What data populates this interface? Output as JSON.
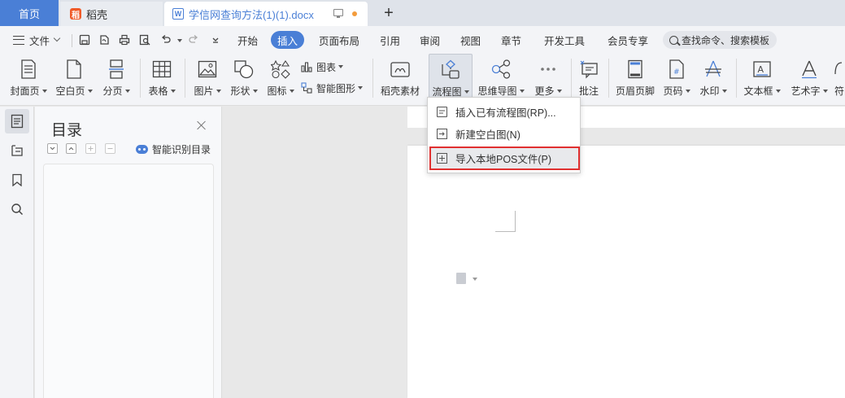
{
  "tabs": {
    "home": "首页",
    "daoke": "稻壳",
    "doc": "学信网查询方法(1)(1).docx",
    "add": "+"
  },
  "menu": {
    "file": "文件",
    "tabs": [
      "开始",
      "插入",
      "页面布局",
      "引用",
      "审阅",
      "视图",
      "章节",
      "开发工具",
      "会员专享"
    ],
    "active_tab": "插入",
    "search": "查找命令、搜索模板"
  },
  "ribbon": {
    "cover": "封面页",
    "blank": "空白页",
    "pagebreak": "分页",
    "table": "表格",
    "picture": "图片",
    "shape": "形状",
    "icon": "图标",
    "chart": "图表",
    "smartart": "智能图形",
    "daoke_material": "稻壳素材",
    "flowchart": "流程图",
    "mindmap": "思维导图",
    "more": "更多",
    "comment": "批注",
    "header_footer": "页眉页脚",
    "page_number": "页码",
    "watermark": "水印",
    "textbox": "文本框",
    "wordart": "艺术字",
    "symbol": "符"
  },
  "panel": {
    "title": "目录",
    "smart_recognize": "智能识别目录"
  },
  "dropdown": {
    "items": [
      "插入已有流程图(RP)...",
      "新建空白图(N)",
      "导入本地POS文件(P)"
    ],
    "highlight_color": "#e03030"
  },
  "colors": {
    "accent": "#4a7fd6",
    "highlight_border": "#e03030"
  }
}
